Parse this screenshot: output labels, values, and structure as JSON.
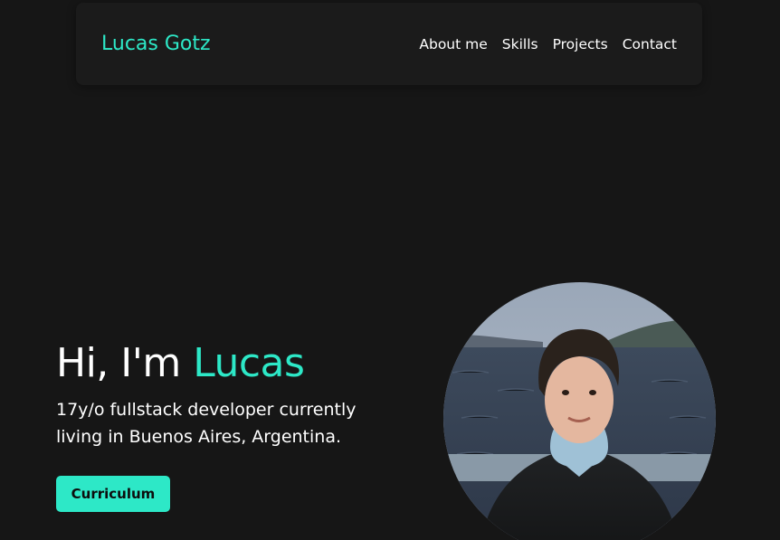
{
  "nav": {
    "brand": "Lucas Gotz",
    "links": [
      "About me",
      "Skills",
      "Projects",
      "Contact"
    ]
  },
  "hero": {
    "greeting": "Hi, I'm ",
    "name": "Lucas",
    "subtitle": "17y/o fullstack developer currently living in Buenos Aires, Argentina.",
    "button_label": "Curriculum"
  },
  "colors": {
    "accent": "#2de8c7",
    "background": "#161616",
    "navbar": "#1b1b1b"
  }
}
